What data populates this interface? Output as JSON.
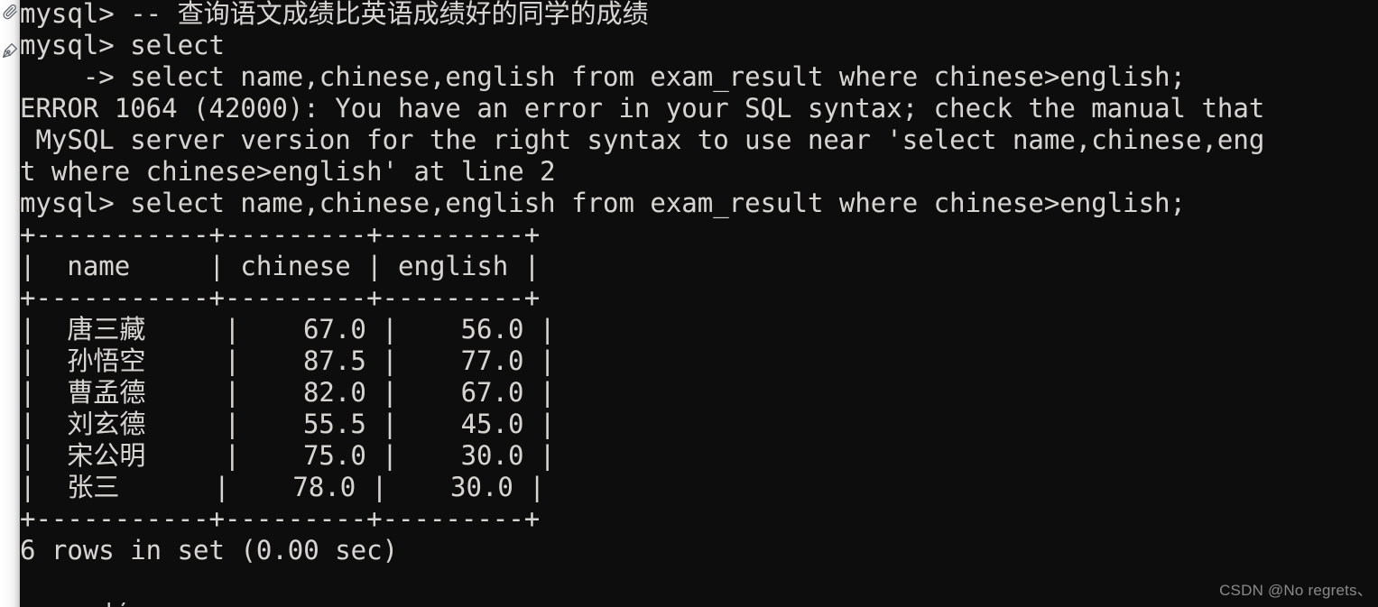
{
  "window": {
    "background_color": "#0d0d0d",
    "text_color": "#d6d4d0",
    "gutter_color": "#f2f2f2"
  },
  "gutter": {
    "icons": [
      {
        "name": "paperclip-icon",
        "label": "attachment"
      },
      {
        "name": "pen-nib-icon",
        "label": "annotate"
      }
    ]
  },
  "terminal": {
    "prompt": "mysql>",
    "continuation_prompt": "->",
    "lines": [
      "mysql> -- 查询语文成绩比英语成绩好的同学的成绩",
      "mysql> select",
      "    -> select name,chinese,english from exam_result where chinese>english;",
      "ERROR 1064 (42000): You have an error in your SQL syntax; check the manual that",
      " MySQL server version for the right syntax to use near 'select name,chinese,eng",
      "t where chinese>english' at line 2",
      "mysql> select name,chinese,english from exam_result where chinese>english;",
      "+-----------+---------+---------+",
      "|  name     | chinese | english |",
      "+-----------+---------+---------+",
      "|  唐三藏     |    67.0 |    56.0 |",
      "|  孙悟空     |    87.5 |    77.0 |",
      "|  曹孟德     |    82.0 |    67.0 |",
      "|  刘玄德     |    55.5 |    45.0 |",
      "|  宋公明     |    75.0 |    30.0 |",
      "|  张三      |    78.0 |    30.0 |",
      "+-----------+---------+---------+",
      "6 rows in set (0.00 sec)",
      ""
    ],
    "commands": {
      "comment_line": "-- 查询语文成绩比英语成绩好的同学的成绩",
      "incomplete_statement": "select",
      "continuation_statement": "select name,chinese,english from exam_result where chinese>english;",
      "successful_statement": "select name,chinese,english from exam_result where chinese>english;"
    },
    "error": {
      "code": "ERROR 1064 (42000)",
      "message": "You have an error in your SQL syntax; check the manual that MySQL server version for the right syntax to use near 'select name,chinese,eng",
      "tail": "t where chinese>english' at line 2",
      "line_reference": "at line 2"
    },
    "result_table": {
      "columns": [
        "name",
        "chinese",
        "english"
      ],
      "rows": [
        {
          "name": "唐三藏",
          "chinese": "67.0",
          "english": "56.0"
        },
        {
          "name": "孙悟空",
          "chinese": "87.5",
          "english": "77.0"
        },
        {
          "name": "曹孟德",
          "chinese": "82.0",
          "english": "67.0"
        },
        {
          "name": "刘玄德",
          "chinese": "55.5",
          "english": "45.0"
        },
        {
          "name": "宋公明",
          "chinese": "75.0",
          "english": "30.0"
        },
        {
          "name": "张三",
          "chinese": "78.0",
          "english": "30.0"
        }
      ],
      "status": "6 rows in set (0.00 sec)",
      "row_count": 6,
      "elapsed": "0.00 sec",
      "border_top": "+-----------+---------+---------+",
      "border_mid": "+-----------+---------+---------+",
      "border_bottom": "+-----------+---------+---------+"
    },
    "bottom_partial_glyph": "|)"
  },
  "watermark": {
    "text": "CSDN @No regrets、"
  }
}
